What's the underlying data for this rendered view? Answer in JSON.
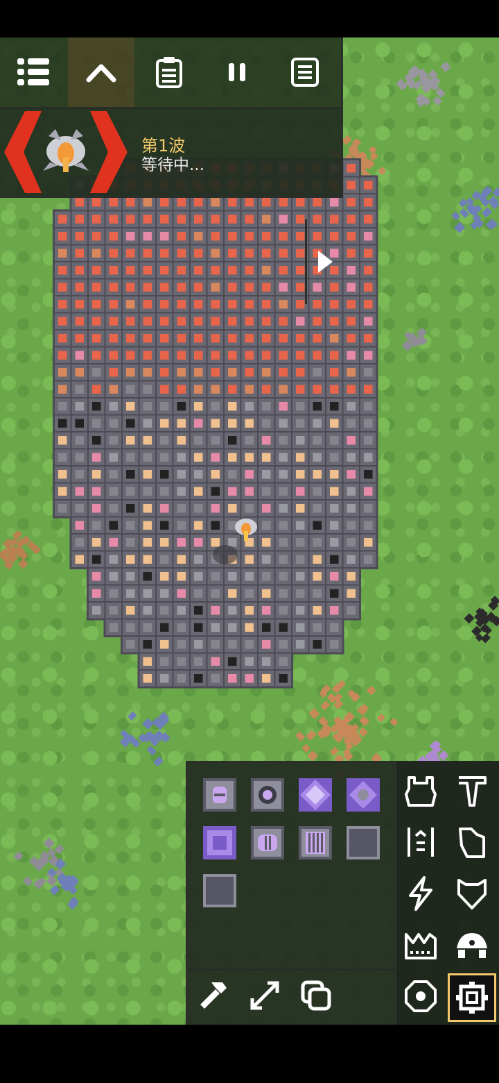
{
  "toolbar": {
    "buttons": [
      {
        "name": "menu-list",
        "icon": "list-icon"
      },
      {
        "name": "collapse",
        "icon": "chevron-up-icon"
      },
      {
        "name": "objectives",
        "icon": "clipboard-icon"
      },
      {
        "name": "pause",
        "icon": "pause-icon"
      },
      {
        "name": "database",
        "icon": "document-icon"
      }
    ]
  },
  "wave": {
    "title": "第1波",
    "status": "等待中..."
  },
  "build": {
    "categories": [
      "turret",
      "production",
      "distribution",
      "liquid",
      "power",
      "defense",
      "crafting",
      "units",
      "effect",
      "logic"
    ],
    "selected_category": "logic",
    "tools": [
      "hammer-icon",
      "expand-icon",
      "copy-icon"
    ]
  },
  "colors": {
    "grass": "#6aa84a",
    "panel": "#24301e",
    "accent": "#f3c96b",
    "enemy_marker": "#e0321e"
  }
}
